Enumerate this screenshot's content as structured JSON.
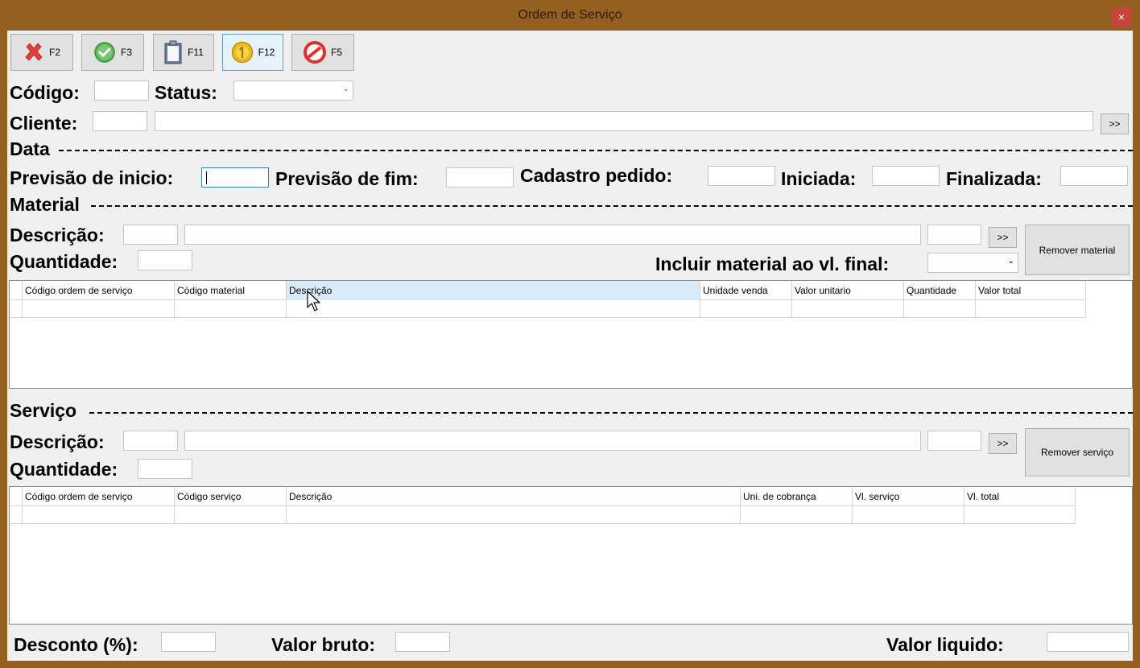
{
  "window": {
    "title": "Ordem de Serviço",
    "close_label": "×",
    "frame_color": "#95601f"
  },
  "toolbar": {
    "buttons": [
      {
        "key": "F2",
        "icon": "cancel-x-icon"
      },
      {
        "key": "F3",
        "icon": "confirm-check-icon"
      },
      {
        "key": "F11",
        "icon": "clipboard-icon"
      },
      {
        "key": "F12",
        "icon": "coin-icon"
      },
      {
        "key": "F5",
        "icon": "forbidden-icon"
      }
    ]
  },
  "header": {
    "codigo_label": "Código:",
    "codigo_value": "",
    "status_label": "Status:",
    "status_value": "",
    "cliente_label": "Cliente:",
    "cliente_code": "",
    "cliente_name": "",
    "cliente_search_label": ">>"
  },
  "data_section": {
    "title": "Data",
    "previsao_inicio_label": "Previsão de inicio:",
    "previsao_fim_label": "Previsão de fim:",
    "cadastro_label": "Cadastro pedido:",
    "iniciada_label": "Iniciada:",
    "finalizada_label": "Finalizada:"
  },
  "material": {
    "title": "Material",
    "descricao_label": "Descrição:",
    "quantidade_label": "Quantidade:",
    "search_label": ">>",
    "remove_label": "Remover material",
    "incluir_label": "Incluir material ao vl. final:",
    "incluir_value": "",
    "columns": [
      "Código ordem de serviço",
      "Código material",
      "Descrição",
      "Unidade venda",
      "Valor unitario",
      "Quantidade",
      "Valor total"
    ]
  },
  "servico": {
    "title": "Serviço",
    "descricao_label": "Descrição:",
    "quantidade_label": "Quantidade:",
    "search_label": ">>",
    "remove_label": "Remover serviço",
    "columns": [
      "Código ordem de serviço",
      "Código serviço",
      "Descrição",
      "Uni. de cobrança",
      "Vl. serviço",
      "Vl. total"
    ]
  },
  "footer": {
    "desconto_label": "Desconto (%):",
    "valor_bruto_label": "Valor bruto:",
    "valor_liquido_label": "Valor liquido:"
  }
}
